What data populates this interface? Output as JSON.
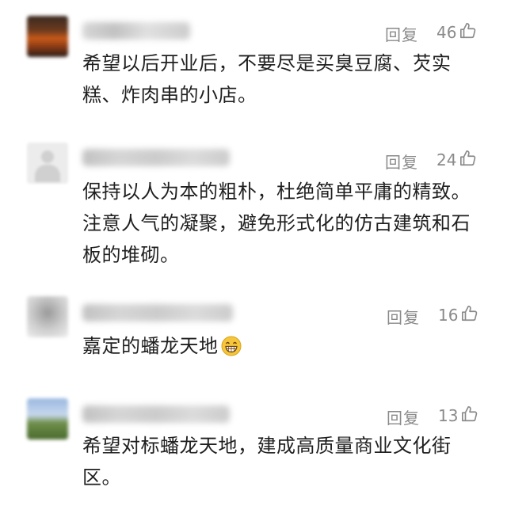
{
  "comments": [
    {
      "reply_label": "回复",
      "likes": "46",
      "text": "希望以后开业后，不要尽是买臭豆腐、芡实糕、炸肉串的小店。"
    },
    {
      "reply_label": "回复",
      "likes": "24",
      "text": "保持以人为本的粗朴，杜绝简单平庸的精致。注意人气的凝聚，避免形式化的仿古建筑和石板的堆砌。"
    },
    {
      "reply_label": "回复",
      "likes": "16",
      "text": "嘉定的蟠龙天地",
      "emoji": "grinning-face-emoji"
    },
    {
      "reply_label": "回复",
      "likes": "13",
      "text": "希望对标蟠龙天地，建成高质量商业文化街区。"
    }
  ],
  "icons": {
    "like": "thumbs-up-icon"
  },
  "colors": {
    "meta_text": "#8a8a8a",
    "body_text": "#1f1f1f",
    "emoji_face": "#f5c63b"
  }
}
